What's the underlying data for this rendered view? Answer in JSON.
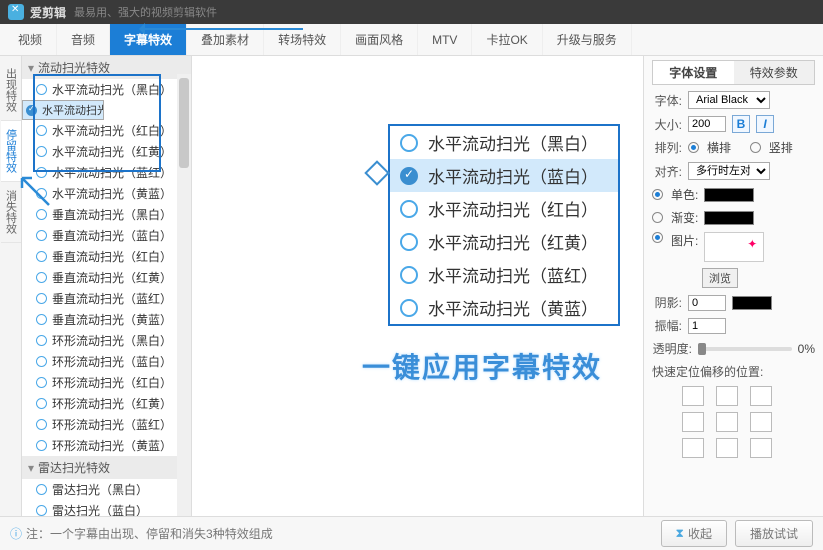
{
  "title": {
    "app": "爱剪辑",
    "sub": "最易用、强大的视频剪辑软件"
  },
  "tabs": [
    "视频",
    "音频",
    "字幕特效",
    "叠加素材",
    "转场特效",
    "画面风格",
    "MTV",
    "卡拉OK",
    "升级与服务"
  ],
  "tabs_active": 2,
  "left_vtabs": [
    {
      "label": "出现特效"
    },
    {
      "label": "停留特效",
      "active": true
    },
    {
      "label": "消失特效"
    }
  ],
  "list": {
    "group1": "流动扫光特效",
    "items1": [
      "水平流动扫光（黑白）",
      "水平流动扫光（蓝白）",
      "水平流动扫光（红白）",
      "水平流动扫光（红黄）",
      "水平流动扫光（蓝红）",
      "水平流动扫光（黄蓝）"
    ],
    "sel1": 1,
    "items_extra": [
      "垂直流动扫光（黑白）",
      "垂直流动扫光（蓝白）",
      "垂直流动扫光（红白）",
      "垂直流动扫光（红黄）",
      "垂直流动扫光（蓝红）",
      "垂直流动扫光（黄蓝）",
      "环形流动扫光（黑白）",
      "环形流动扫光（蓝白）",
      "环形流动扫光（红白）",
      "环形流动扫光（红黄）",
      "环形流动扫光（蓝红）",
      "环形流动扫光（黄蓝）"
    ],
    "group2": "雷达扫光特效",
    "items2": [
      "雷达扫光（黑白）",
      "雷达扫光（蓝白）"
    ]
  },
  "annot": {
    "items": [
      "水平流动扫光（黑白）",
      "水平流动扫光（蓝白）",
      "水平流动扫光（红白）",
      "水平流动扫光（红黄）",
      "水平流动扫光（蓝红）",
      "水平流动扫光（黄蓝）"
    ],
    "sel": 1,
    "caption": "一键应用字幕特效"
  },
  "right": {
    "tabs": [
      "字体设置",
      "特效参数"
    ],
    "font_label": "字体:",
    "font_value": "Arial Black",
    "size_label": "大小:",
    "size_value": "200",
    "arrange_label": "排列:",
    "arrange_h": "横排",
    "arrange_v": "竖排",
    "align_label": "对齐:",
    "align_value": "多行时左对齐",
    "solid_label": "单色:",
    "grad_label": "渐变:",
    "pic_label": "图片:",
    "browse": "浏览",
    "shadow_label": "阴影:",
    "shadow_value": "0",
    "amp_label": "振幅:",
    "amp_value": "1",
    "opacity_label": "透明度:",
    "opacity_value": "0%",
    "anchor_label": "快速定位偏移的位置:"
  },
  "footer": {
    "note": "注：一个字幕由出现、停留和消失3种特效组成",
    "collapse": "收起",
    "play": "播放试试"
  }
}
